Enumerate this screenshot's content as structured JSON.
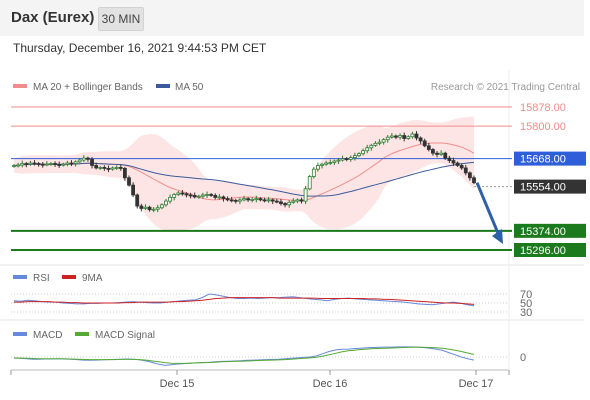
{
  "header": {
    "title": "Dax (Eurex)",
    "interval": "30 MIN"
  },
  "timestamp": "Thursday, December 16, 2021 9:44:53 PM CET",
  "legend": {
    "ma20": "MA 20 + Bollinger Bands",
    "ma50": "MA 50",
    "credit": "Research © 2021 Trading Central"
  },
  "colors": {
    "bullish": "#2e7d32",
    "bearish": "#333333",
    "band": "#fde0e0",
    "ma20": "#f28c8c",
    "ma50": "#3a5a9b",
    "resistance": "#f28c8c",
    "support": "#1b7a1b",
    "pivot": "#2f5fd8",
    "current": "#333333",
    "arrow": "#2f5fa8",
    "rsi": "#6688dd",
    "rsi_ma": "#cc2222",
    "macd": "#6688dd",
    "macd_signal": "#55aa33"
  },
  "levels": [
    {
      "value": 15878.0,
      "label": "15878.00",
      "type": "resistance"
    },
    {
      "value": 15800.0,
      "label": "15800.00",
      "type": "resistance"
    },
    {
      "value": 15668.0,
      "label": "15668.00",
      "type": "pivot"
    },
    {
      "value": 15554.0,
      "label": "15554.00",
      "type": "current"
    },
    {
      "value": 15374.0,
      "label": "15374.00",
      "type": "support"
    },
    {
      "value": 15296.0,
      "label": "15296.00",
      "type": "support"
    }
  ],
  "rsi_panel": {
    "label": "RSI",
    "ma_label": "9MA",
    "levels": [
      "70",
      "50",
      "30"
    ]
  },
  "macd_panel": {
    "label": "MACD",
    "signal_label": "MACD Signal",
    "zero_label": "0"
  },
  "x_axis": {
    "labels": [
      "Dec 15",
      "Dec 16",
      "Dec 17"
    ]
  },
  "chart_data": {
    "type": "candlestick",
    "symbol": "Dax (Eurex)",
    "interval": "30 MIN",
    "ylim": [
      15296,
      15900
    ],
    "close_series": [
      15640,
      15642,
      15648,
      15645,
      15650,
      15648,
      15645,
      15643,
      15646,
      15648,
      15644,
      15642,
      15645,
      15650,
      15648,
      15655,
      15662,
      15670,
      15665,
      15640,
      15630,
      15632,
      15628,
      15625,
      15630,
      15632,
      15628,
      15590,
      15560,
      15520,
      15475,
      15465,
      15470,
      15460,
      15462,
      15468,
      15480,
      15495,
      15510,
      15522,
      15528,
      15525,
      15520,
      15518,
      15512,
      15515,
      15520,
      15522,
      15518,
      15510,
      15512,
      15505,
      15500,
      15498,
      15495,
      15500,
      15505,
      15500,
      15502,
      15505,
      15500,
      15498,
      15500,
      15495,
      15492,
      15485,
      15480,
      15490,
      15495,
      15500,
      15495,
      15545,
      15595,
      15625,
      15640,
      15645,
      15650,
      15652,
      15658,
      15662,
      15668,
      15665,
      15672,
      15680,
      15688,
      15700,
      15712,
      15722,
      15730,
      15735,
      15745,
      15755,
      15760,
      15755,
      15762,
      15750,
      15757,
      15768,
      15752,
      15740,
      15720,
      15705,
      15690,
      15685,
      15690,
      15670,
      15660,
      15650,
      15640,
      15630,
      15610,
      15590,
      15570
    ]
  },
  "rsi_data": [
    55,
    54,
    56,
    55,
    53,
    52,
    52,
    50,
    49,
    48,
    48,
    49,
    49,
    50,
    50,
    51,
    52,
    53,
    52,
    51,
    50,
    50,
    52,
    53,
    55,
    56,
    57,
    62,
    70,
    68,
    65,
    62,
    60,
    60,
    61,
    60,
    61,
    62,
    62,
    63,
    64,
    62,
    60,
    58,
    57,
    55,
    58,
    60,
    61,
    59,
    58,
    57,
    56,
    55,
    54,
    53,
    52,
    50,
    48,
    47,
    46,
    48,
    50,
    52,
    50,
    46,
    44
  ],
  "rsi_ma_data": [
    52,
    52,
    53,
    53,
    53,
    53,
    52,
    52,
    51,
    51,
    50,
    50,
    50,
    50,
    50,
    50,
    51,
    51,
    52,
    52,
    52,
    52,
    52,
    53,
    53,
    54,
    55,
    56,
    58,
    60,
    61,
    62,
    62,
    62,
    62,
    62,
    62,
    62,
    61,
    61,
    61,
    61,
    61,
    61,
    60,
    60,
    60,
    60,
    60,
    60,
    60,
    59,
    59,
    58,
    58,
    57,
    56,
    55,
    54,
    53,
    52,
    51,
    50,
    50,
    49,
    48,
    47
  ],
  "macd_data": [
    -5,
    -6,
    -8,
    -10,
    -10,
    -9,
    -9,
    -8,
    -9,
    -10,
    -12,
    -14,
    -15,
    -14,
    -13,
    -12,
    -11,
    -10,
    -9,
    -10,
    -13,
    -18,
    -25,
    -33,
    -38,
    -35,
    -32,
    -30,
    -28,
    -26,
    -25,
    -24,
    -22,
    -20,
    -19,
    -18,
    -17,
    -15,
    -14,
    -13,
    -12,
    -11,
    -10,
    -8,
    -6,
    -4,
    -2,
    0,
    5,
    15,
    25,
    32,
    35,
    36,
    38,
    40,
    42,
    43,
    44,
    45,
    45,
    46,
    46,
    46,
    45,
    43,
    40,
    36,
    30,
    20,
    10,
    0,
    -8,
    -14
  ],
  "macd_signal_data": [
    -4,
    -5,
    -6,
    -7,
    -8,
    -8,
    -8,
    -8,
    -8,
    -9,
    -10,
    -11,
    -12,
    -12,
    -12,
    -12,
    -12,
    -11,
    -11,
    -11,
    -12,
    -14,
    -18,
    -22,
    -26,
    -28,
    -29,
    -29,
    -28,
    -27,
    -26,
    -25,
    -24,
    -22,
    -21,
    -20,
    -19,
    -18,
    -17,
    -16,
    -15,
    -14,
    -13,
    -12,
    -10,
    -8,
    -6,
    -4,
    -1,
    4,
    10,
    17,
    23,
    28,
    31,
    34,
    36,
    38,
    39,
    40,
    41,
    42,
    43,
    44,
    44,
    44,
    43,
    42,
    40,
    36,
    31,
    25,
    18,
    12
  ]
}
